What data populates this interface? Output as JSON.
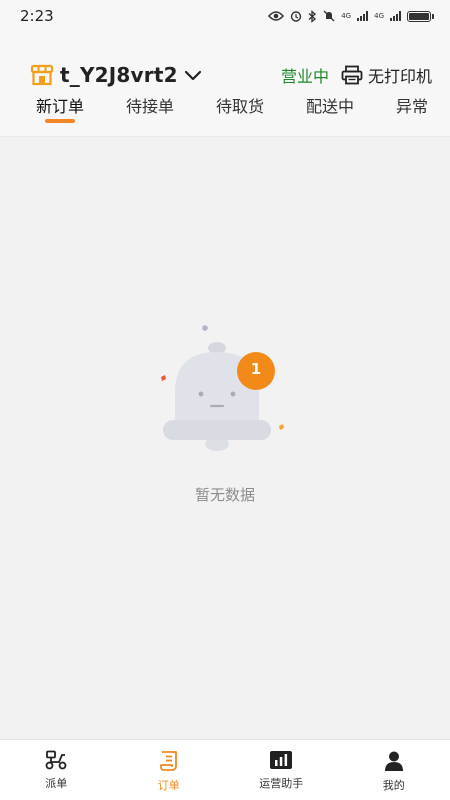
{
  "status_bar": {
    "time": "2:23",
    "network_label_1": "4G",
    "network_label_2": "4G"
  },
  "header": {
    "store_name": "t_Y2J8vrt2",
    "business_status": "营业中",
    "printer_status": "无打印机",
    "tabs": [
      {
        "label": "新订单",
        "active": true
      },
      {
        "label": "待接单",
        "active": false
      },
      {
        "label": "待取货",
        "active": false
      },
      {
        "label": "配送中",
        "active": false
      },
      {
        "label": "异常",
        "active": false
      }
    ]
  },
  "empty_state": {
    "badge_count": "1",
    "message": "暂无数据"
  },
  "bottom_nav": [
    {
      "label": "派单",
      "icon": "scooter-icon",
      "active": false
    },
    {
      "label": "订单",
      "icon": "order-list-icon",
      "active": true
    },
    {
      "label": "运营助手",
      "icon": "chart-icon",
      "active": false
    },
    {
      "label": "我的",
      "icon": "user-icon",
      "active": false
    }
  ],
  "colors": {
    "accent": "#f2872a",
    "open_status": "#1e8a2c",
    "background": "#f2f2f2"
  }
}
